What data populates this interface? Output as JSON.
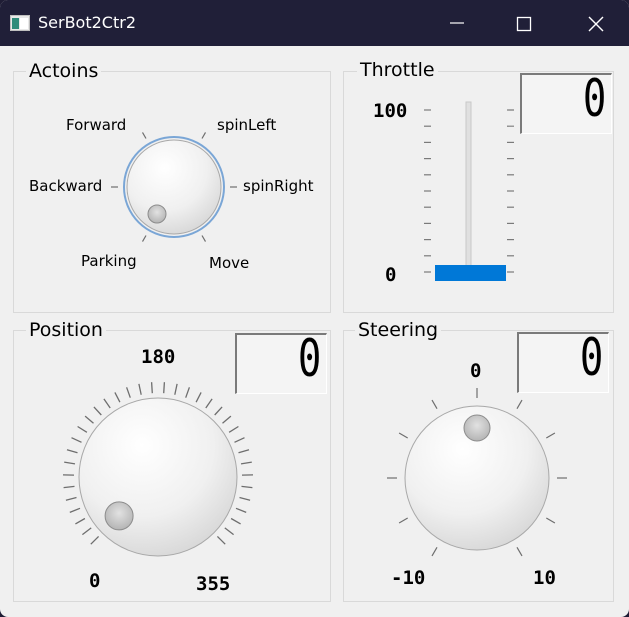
{
  "window": {
    "title": "SerBot2Ctr2",
    "icons": [
      "app-icon",
      "minimize-icon",
      "maximize-icon",
      "close-icon"
    ]
  },
  "actions": {
    "title": "Actoins",
    "labels": {
      "forward": "Forward",
      "spin_left": "spinLeft",
      "backward": "Backward",
      "spin_right": "spinRight",
      "parking": "Parking",
      "move": "Move"
    },
    "selected": "Parking"
  },
  "throttle": {
    "title": "Throttle",
    "max_label": "100",
    "min_label": "0",
    "value": 0,
    "display": "0"
  },
  "position": {
    "title": "Position",
    "label_top": "180",
    "label_min": "0",
    "label_max": "355",
    "value": 0,
    "display": "0"
  },
  "steering": {
    "title": "Steering",
    "label_top": "0",
    "label_min": "-10",
    "label_max": "10",
    "value": 0,
    "display": "0"
  },
  "colors": {
    "titlebar": "#201f38",
    "accent": "#0078d7",
    "dial_focus": "#7aa6d6"
  }
}
